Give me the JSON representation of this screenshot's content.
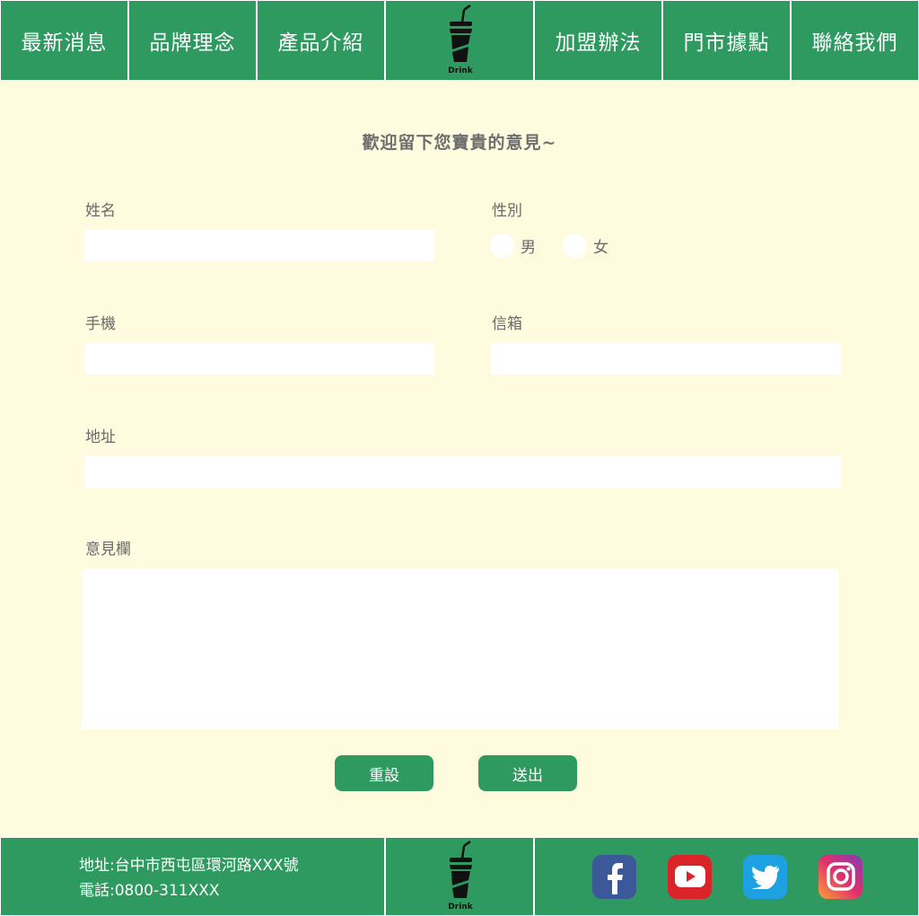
{
  "nav": {
    "items_left": [
      "最新消息",
      "品牌理念",
      "產品介紹"
    ],
    "items_right": [
      "加盟辦法",
      "門市據點",
      "聯絡我們"
    ],
    "logo_text": "Drink"
  },
  "form": {
    "title": "歡迎留下您寶貴的意見~",
    "name_label": "姓名",
    "gender_label": "性別",
    "gender_options": [
      "男",
      "女"
    ],
    "phone_label": "手機",
    "email_label": "信箱",
    "address_label": "地址",
    "comment_label": "意見欄",
    "name_value": "",
    "phone_value": "",
    "email_value": "",
    "address_value": "",
    "comment_value": "",
    "reset_label": "重設",
    "submit_label": "送出"
  },
  "footer": {
    "address": "地址:台中市西屯區環河路XXX號",
    "phone": "電話:0800-311XXX",
    "logo_text": "Drink",
    "social": [
      "facebook-icon",
      "youtube-icon",
      "twitter-icon",
      "instagram-icon"
    ]
  },
  "colors": {
    "brand_green": "#2e9a60",
    "background": "#fffbdf",
    "facebook": "#3b5998",
    "youtube": "#d9252a",
    "twitter": "#1da1e0",
    "instagram": "#c13584"
  }
}
